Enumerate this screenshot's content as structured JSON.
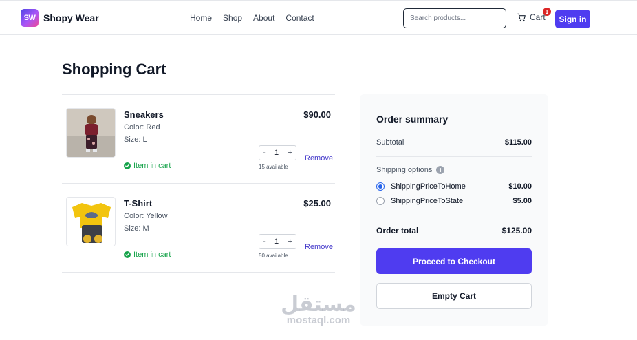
{
  "header": {
    "logo_text": "SW",
    "brand": "Shopy Wear",
    "nav": [
      "Home",
      "Shop",
      "About",
      "Contact"
    ],
    "search_placeholder": "Search products...",
    "cart_label": "Cart",
    "cart_count": "1",
    "signin_label": "Sign in"
  },
  "page_title": "Shopping Cart",
  "cart": {
    "items": [
      {
        "name": "Sneakers",
        "color": "Color: Red",
        "size": "Size: L",
        "price": "$90.00",
        "status": "Item in cart",
        "qty": "1",
        "available": "15 available",
        "remove_label": "Remove"
      },
      {
        "name": "T-Shirt",
        "color": "Color: Yellow",
        "size": "Size: M",
        "price": "$25.00",
        "status": "Item in cart",
        "qty": "1",
        "available": "50 available",
        "remove_label": "Remove"
      }
    ]
  },
  "summary": {
    "title": "Order summary",
    "subtotal_label": "Subtotal",
    "subtotal_value": "$115.00",
    "shipping_label": "Shipping options",
    "options": [
      {
        "label": "ShippingPriceToHome",
        "price": "$10.00",
        "selected": true
      },
      {
        "label": "ShippingPriceToState",
        "price": "$5.00",
        "selected": false
      }
    ],
    "total_label": "Order total",
    "total_value": "$125.00",
    "checkout_label": "Proceed to Checkout",
    "empty_label": "Empty Cart"
  },
  "watermark": {
    "arabic": "مستقل",
    "latin": "mostaql.com"
  },
  "colors": {
    "accent": "#4f3cf0",
    "success": "#16a34a",
    "badge": "#dc2626",
    "link": "#4338ca"
  }
}
